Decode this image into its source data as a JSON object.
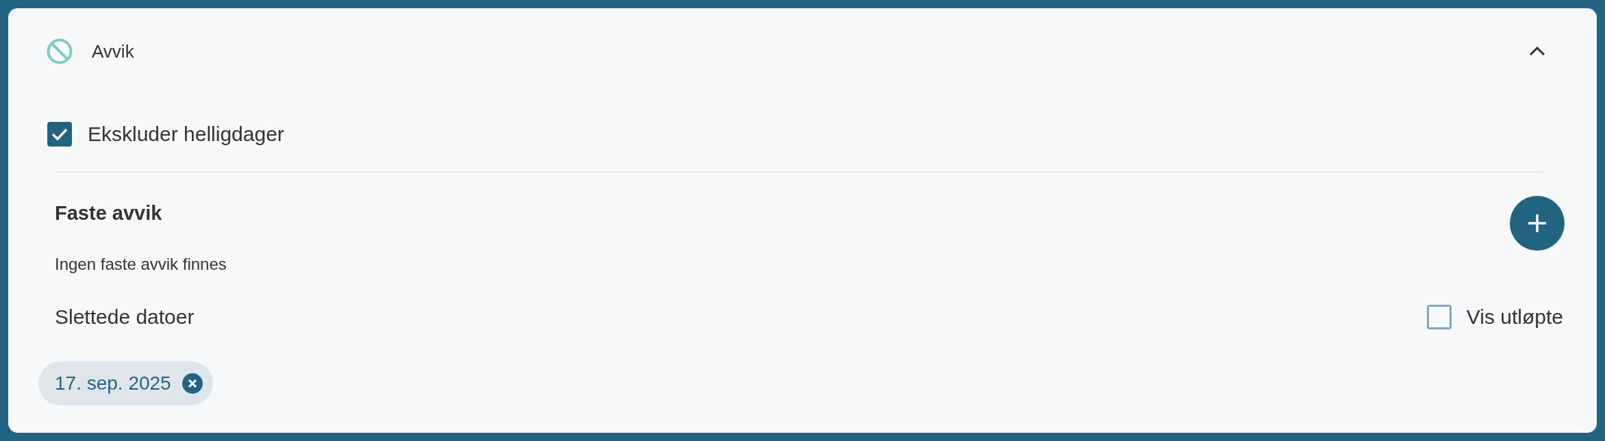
{
  "section": {
    "title": "Avvik",
    "expanded": true
  },
  "exclude_holidays": {
    "label": "Ekskluder helligdager",
    "checked": true
  },
  "fixed_deviations": {
    "heading": "Faste avvik",
    "empty_text": "Ingen faste avvik finnes"
  },
  "deleted_dates": {
    "heading": "Slettede datoer",
    "show_expired": {
      "label": "Vis utløpte",
      "checked": false
    },
    "chips": [
      {
        "label": "17. sep. 2025"
      }
    ]
  }
}
